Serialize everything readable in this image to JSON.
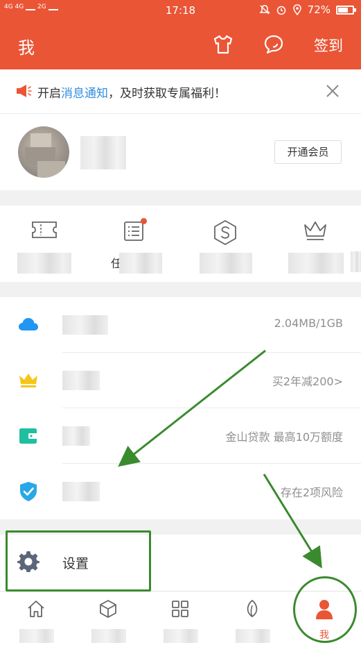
{
  "status_bar": {
    "network_left": "4G 4G",
    "network_right": "2G",
    "time": "17:18",
    "battery_percent": "72%",
    "battery_level": 0.72
  },
  "header": {
    "title": "我",
    "sign_in_label": "签到",
    "bg_color": "#ea5536"
  },
  "notice": {
    "text_prefix": "开启",
    "text_link": "消息通知",
    "text_suffix": "，及时获取专属福利！",
    "link_color": "#2f8ee0"
  },
  "profile": {
    "vip_button_label": "开通会员"
  },
  "quick_items": [
    {
      "icon": "ticket-icon",
      "label": ""
    },
    {
      "icon": "document-list-icon",
      "label": "任",
      "badge": true
    },
    {
      "icon": "hexagon-s-icon",
      "label": ""
    },
    {
      "icon": "crown-outline-icon",
      "label": ""
    }
  ],
  "list_rows": [
    {
      "icon": "cloud-icon",
      "icon_color": "#2196f3",
      "right_text": "2.04MB/1GB"
    },
    {
      "icon": "crown-icon",
      "icon_color": "#f5c518",
      "right_text": "买2年减200>"
    },
    {
      "icon": "wallet-icon",
      "icon_color": "#1fbf9f",
      "right_text": "金山贷款 最高10万额度"
    },
    {
      "icon": "shield-check-icon",
      "icon_color": "#29a8e8",
      "right_text": "存在2项风险"
    }
  ],
  "settings": {
    "label": "设置"
  },
  "tab_bar": {
    "tabs": [
      {
        "icon": "home-icon",
        "label": ""
      },
      {
        "icon": "cube-icon",
        "label": ""
      },
      {
        "icon": "grid-icon",
        "label": ""
      },
      {
        "icon": "leaf-icon",
        "label": ""
      },
      {
        "icon": "person-icon",
        "label": "我"
      }
    ],
    "active_color": "#ea5536"
  },
  "annotation_color": "#3a8a2e"
}
